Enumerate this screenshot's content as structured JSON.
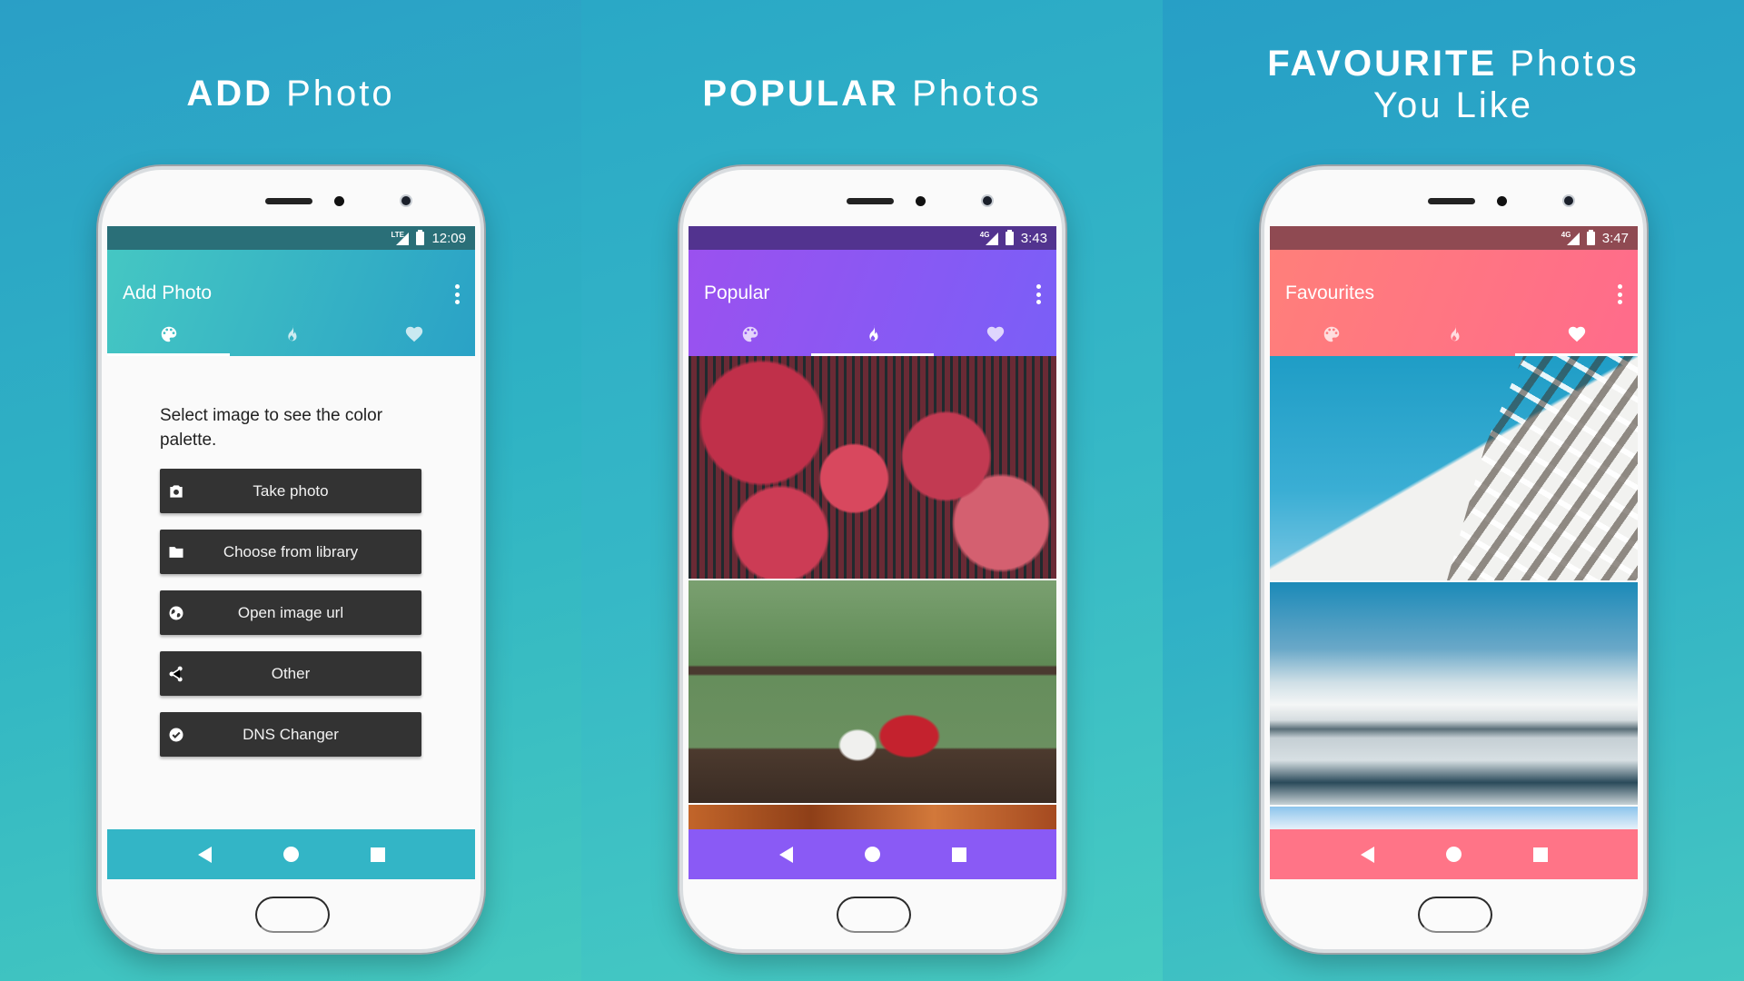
{
  "panels": [
    {
      "headline_bold": "ADD",
      "headline_light": "Photo",
      "headline_line2": "",
      "status": {
        "network": "LTE",
        "time": "12:09"
      },
      "app_title": "Add Photo",
      "active_tab": "palette",
      "colors": {
        "status": "#2a6f78",
        "appbar_from": "#45c7c3",
        "appbar_to": "#2aa2c6",
        "nav": "#33b5c6"
      }
    },
    {
      "headline_bold": "POPULAR",
      "headline_light": "Photos",
      "headline_line2": "",
      "status": {
        "network": "4G",
        "time": "3:43"
      },
      "app_title": "Popular",
      "active_tab": "popular",
      "colors": {
        "status": "#52338f",
        "appbar_from": "#9b51ef",
        "appbar_to": "#7a5ff7",
        "nav": "#8a5af5"
      }
    },
    {
      "headline_bold": "FAVOURITE",
      "headline_light": "Photos",
      "headline_line2": "You Like",
      "status": {
        "network": "4G",
        "time": "3:47"
      },
      "app_title": "Favourites",
      "active_tab": "favourites",
      "colors": {
        "status": "#8f4a52",
        "appbar_from": "#ff7f7a",
        "appbar_to": "#ff6b8b",
        "nav": "#ff7487"
      }
    }
  ],
  "tabs": [
    "palette",
    "popular",
    "favourites"
  ],
  "add_photo": {
    "intro": "Select image to see the color palette.",
    "buttons": [
      {
        "label": "Take photo",
        "icon": "camera-icon"
      },
      {
        "label": "Choose from library",
        "icon": "folder-icon"
      },
      {
        "label": "Open image url",
        "icon": "globe-icon"
      },
      {
        "label": "Other",
        "icon": "share-icon"
      },
      {
        "label": "DNS Changer",
        "icon": "check-circle-icon"
      }
    ]
  },
  "popular_photos": [
    "pomegranates",
    "red teapot on balcony table",
    "wood texture"
  ],
  "favourite_photos": [
    "white building against blue sky",
    "snowy mountain over frozen lake",
    "sky with clouds"
  ]
}
